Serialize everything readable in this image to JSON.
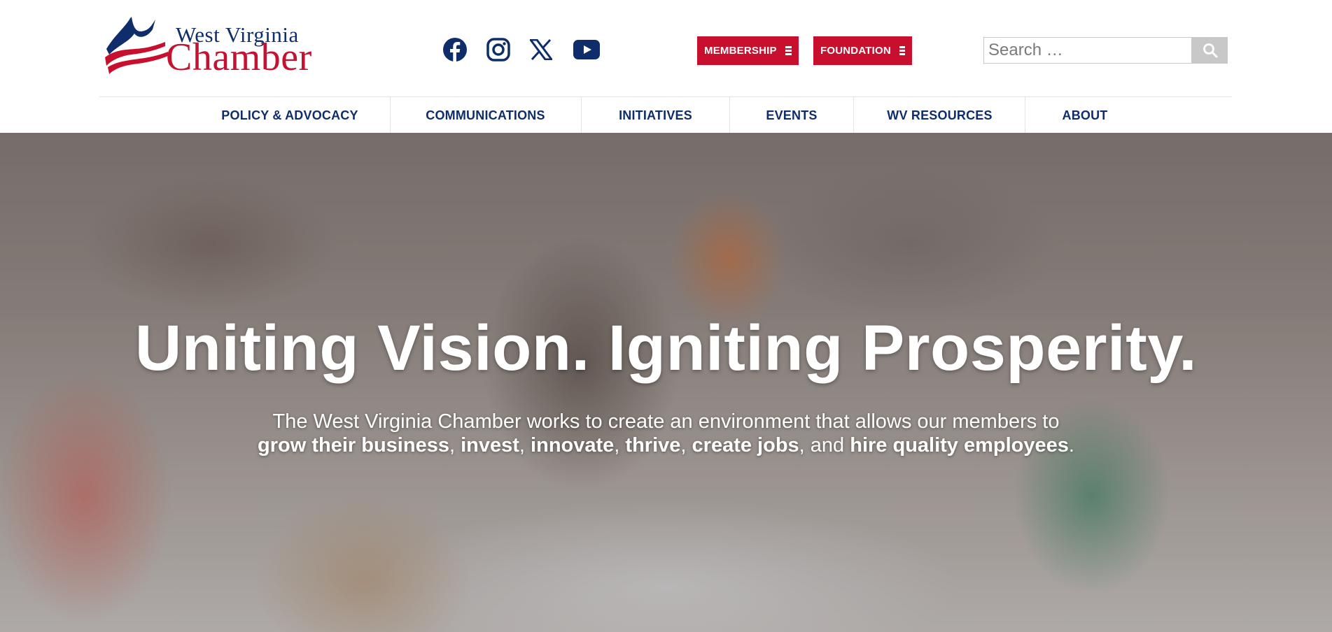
{
  "brand": {
    "logo_line1": "West Virginia",
    "logo_line2": "Chamber",
    "colors": {
      "navy": "#0f2d6b",
      "red": "#c8102e"
    }
  },
  "social": [
    {
      "icon": "facebook-icon"
    },
    {
      "icon": "instagram-icon"
    },
    {
      "icon": "x-icon"
    },
    {
      "icon": "youtube-icon"
    }
  ],
  "menus": {
    "membership_label": "MEMBERSHIP",
    "foundation_label": "FOUNDATION"
  },
  "search": {
    "placeholder": "Search …",
    "value": ""
  },
  "nav": [
    {
      "label": "POLICY & ADVOCACY"
    },
    {
      "label": "COMMUNICATIONS"
    },
    {
      "label": "INITIATIVES"
    },
    {
      "label": "EVENTS"
    },
    {
      "label": "WV RESOURCES"
    },
    {
      "label": "ABOUT"
    }
  ],
  "hero": {
    "title": "Uniting Vision. Igniting Prosperity.",
    "subtitle_line1": "The West Virginia Chamber works to create an environment that allows our members to",
    "subtitle_line2": {
      "p1": "grow their business",
      "s1": ", ",
      "p2": "invest",
      "s2": ", ",
      "p3": "innovate",
      "s3": ", ",
      "p4": "thrive",
      "s4": ", ",
      "p5": "create jobs",
      "s5": ", and ",
      "p6": "hire quality employees",
      "s6": "."
    }
  }
}
